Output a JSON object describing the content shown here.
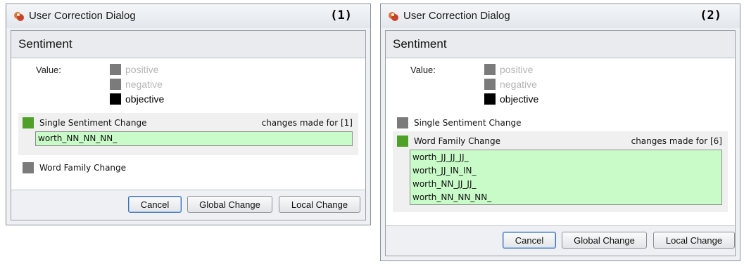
{
  "dialogs": [
    {
      "title": "User Correction Dialog",
      "panel_number": "(1)",
      "header": "Sentiment",
      "value_label": "Value:",
      "options": [
        {
          "label": "positive",
          "enabled": false,
          "color": "#7b7b7b"
        },
        {
          "label": "negative",
          "enabled": false,
          "color": "#7b7b7b"
        },
        {
          "label": "objective",
          "enabled": true,
          "color": "#000000"
        }
      ],
      "single_change": {
        "label": "Single Sentiment Change",
        "selected": true,
        "changes_text": "changes made for [1]",
        "items": [
          "worth_NN_NN_NN_"
        ]
      },
      "family_change": {
        "label": "Word Family Change",
        "selected": false
      },
      "buttons": {
        "cancel": "Cancel",
        "global": "Global Change",
        "local": "Local Change"
      }
    },
    {
      "title": "User Correction Dialog",
      "panel_number": "(2)",
      "header": "Sentiment",
      "value_label": "Value:",
      "options": [
        {
          "label": "positive",
          "enabled": false,
          "color": "#7b7b7b"
        },
        {
          "label": "negative",
          "enabled": false,
          "color": "#7b7b7b"
        },
        {
          "label": "objective",
          "enabled": true,
          "color": "#000000"
        }
      ],
      "single_change": {
        "label": "Single Sentiment Change",
        "selected": false
      },
      "family_change": {
        "label": "Word Family Change",
        "selected": true,
        "changes_text": "changes made for [6]",
        "items": [
          "worth_JJ_JJ_JJ_",
          "worth_JJ_IN_IN_",
          "worth_NN_JJ_JJ_",
          "worth_NN_NN_NN_"
        ]
      },
      "buttons": {
        "cancel": "Cancel",
        "global": "Global Change",
        "local": "Local Change"
      }
    }
  ],
  "colors": {
    "selected_indicator": "#4ea126",
    "unselected_indicator": "#7b7b7b",
    "field_background": "#c9fbc9"
  }
}
